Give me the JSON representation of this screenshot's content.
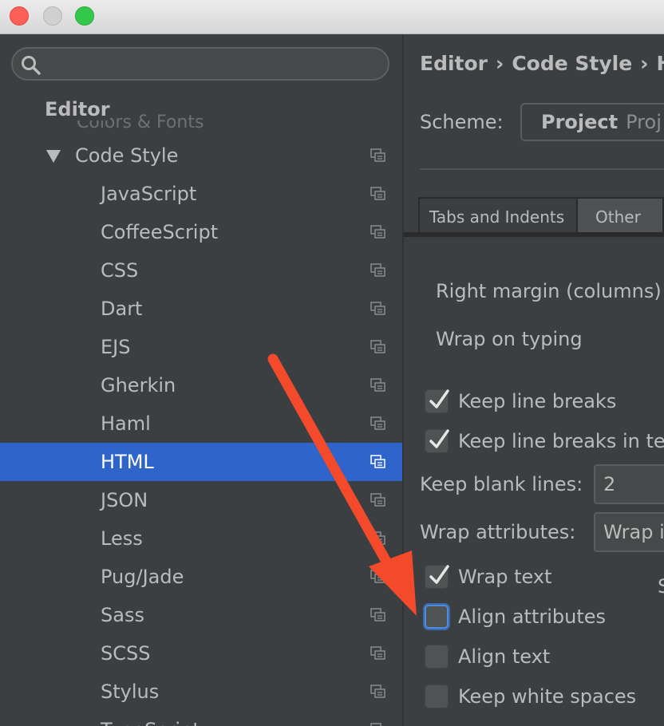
{
  "window": {
    "controls": [
      "close",
      "minimize",
      "zoom"
    ]
  },
  "search": {
    "placeholder": "",
    "icon": "search-icon"
  },
  "tree": {
    "section_heading": "Editor",
    "partially_hidden_item": "Colors & Fonts",
    "parent": {
      "label": "Code Style",
      "expanded": true
    },
    "items": [
      {
        "label": "JavaScript"
      },
      {
        "label": "CoffeeScript"
      },
      {
        "label": "CSS"
      },
      {
        "label": "Dart"
      },
      {
        "label": "EJS"
      },
      {
        "label": "Gherkin"
      },
      {
        "label": "Haml"
      },
      {
        "label": "HTML",
        "selected": true
      },
      {
        "label": "JSON"
      },
      {
        "label": "Less"
      },
      {
        "label": "Pug/Jade"
      },
      {
        "label": "Sass"
      },
      {
        "label": "SCSS"
      },
      {
        "label": "Stylus"
      },
      {
        "label": "TypeScript"
      }
    ]
  },
  "breadcrumb": {
    "items": [
      "Editor",
      "Code Style",
      "H"
    ],
    "separator": "›"
  },
  "scheme": {
    "label": "Scheme:",
    "value": "Project",
    "type": "Proj"
  },
  "tabs": [
    {
      "label": "Tabs and Indents"
    },
    {
      "label": "Other",
      "active": true
    }
  ],
  "options": {
    "right_margin_label": "Right margin (columns)",
    "wrap_on_typing_label": "Wrap on typing",
    "keep_line_breaks": {
      "label": "Keep line breaks",
      "checked": true
    },
    "keep_line_breaks_in_text": {
      "label": "Keep line breaks in te",
      "checked": true
    },
    "keep_blank_lines": {
      "label": "Keep blank lines:",
      "value": "2"
    },
    "wrap_attributes": {
      "label": "Wrap attributes:",
      "value": "Wrap i"
    },
    "wrap_text": {
      "label": "Wrap text",
      "checked": true
    },
    "align_attributes": {
      "label": "Align attributes",
      "checked": false
    },
    "align_text": {
      "label": "Align text",
      "checked": false
    },
    "keep_white_spaces": {
      "label": "Keep white spaces",
      "checked": false
    },
    "cut_off_char": "S"
  },
  "colors": {
    "background": "#3c3f41",
    "selection": "#2f65ca",
    "text": "#bbbbbb",
    "annotation_arrow": "#f24a2a",
    "focus": "#4e8ae0"
  }
}
